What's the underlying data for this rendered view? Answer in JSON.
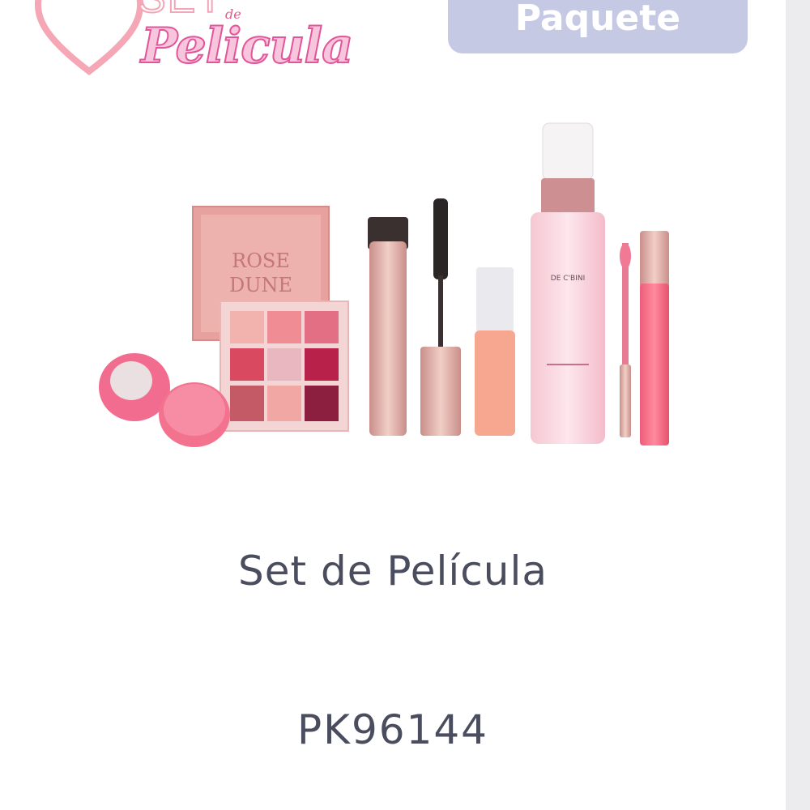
{
  "logo": {
    "line1": "SET",
    "line2": "de",
    "line3": "Pelicula"
  },
  "badge": {
    "label": "Paquete"
  },
  "product_image": {
    "palette_text_line1": "ROSE",
    "palette_text_line2": "DUNE",
    "bottle_label": "DE C'BINI"
  },
  "product": {
    "name": "Set de Película",
    "sku": "PK96144"
  }
}
